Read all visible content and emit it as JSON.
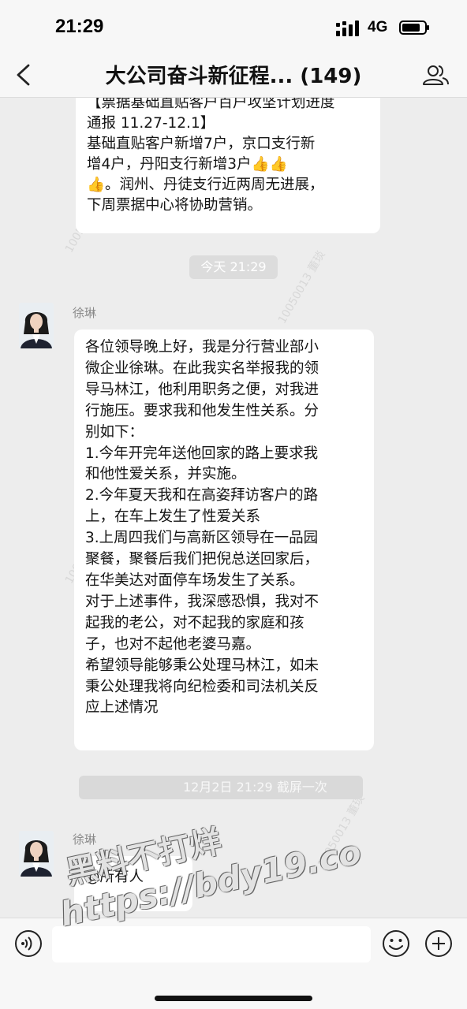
{
  "status_bar": {
    "time": "21:29",
    "network": "4G"
  },
  "header": {
    "title": "大公司奋斗新征程... (149)",
    "back_icon": "back-chevron-icon",
    "members_icon": "group-members-icon"
  },
  "messages": {
    "previous": {
      "lines": [
        "【票据基础直贴客户百户攻坚计划进度",
        "通报 11.27-12.1】",
        "基础直贴客户新增7户，京口支行新",
        "增4户，丹阳支行新增3户👍👍",
        "👍。润州、丹徒支行近两周无进展，",
        "下周票据中心将协助营销。"
      ]
    },
    "time_divider_1": "今天 21:29",
    "main": {
      "sender": "徐琳",
      "lines": [
        "各位领导晚上好，我是分行营业部小",
        "微企业徐琳。在此我实名举报我的领",
        "导马林江，他利用职务之便，对我进",
        "行施压。要求我和他发生性关系。分",
        "别如下：",
        "1.今年开完年送他回家的路上要求我",
        "和他性爱关系，并实施。",
        "2.今年夏天我和在高姿拜访客户的路",
        "上，在车上发生了性爱关系",
        "3.上周四我们与高新区领导在一品园",
        "聚餐，聚餐后我们把倪总送回家后，",
        "在华美达对面停车场发生了关系。",
        "对于上述事件，我深感恐惧，我对不",
        "起我的老公，对不起我的家庭和孩",
        "子，也对不起他老婆马嘉。",
        "希望领导能够秉公处理马林江，如未",
        "秉公处理我将向纪检委和司法机关反",
        "应上述情况"
      ]
    },
    "time_divider_2": "12月2日 21:29 截屏一次",
    "last": {
      "sender": "徐琳",
      "text": "@所有人"
    }
  },
  "watermarks": {
    "chat_id": "10050013 董琰",
    "site_line_1": "黑料不打烊",
    "site_line_2": "https://bdy19.co"
  },
  "input_bar": {
    "placeholder": "",
    "voice_icon": "voice-icon",
    "emoji_icon": "emoji-icon",
    "plus_icon": "plus-icon"
  }
}
